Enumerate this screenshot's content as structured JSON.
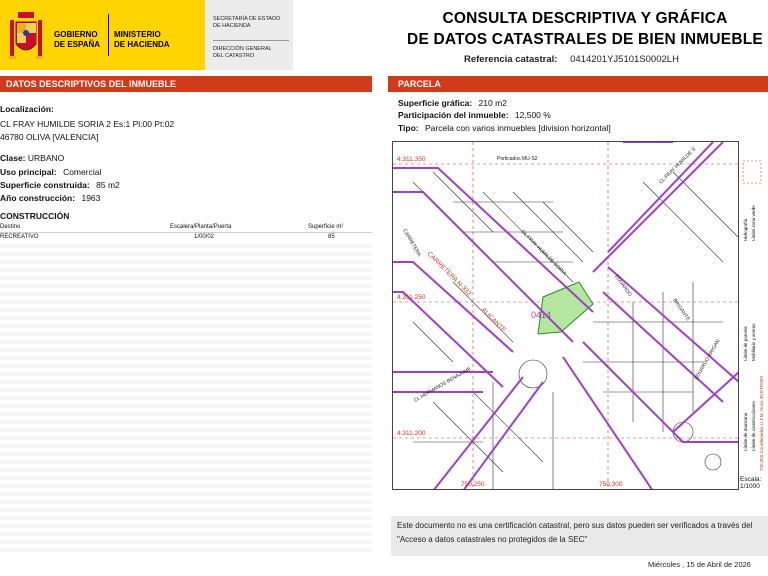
{
  "header": {
    "gobierno": [
      "GOBIERNO",
      "DE ESPAÑA"
    ],
    "ministerio": [
      "MINISTERIO",
      "DE HACIENDA"
    ],
    "secretaria": [
      "SECRETARÍA DE ESTADO",
      "DE HACIENDA"
    ],
    "direccion": [
      "DIRECCIÓN GENERAL",
      "DEL CATASTRO"
    ],
    "title_line1": "CONSULTA DESCRIPTIVA Y GRÁFICA",
    "title_line2": "DE DATOS CATASTRALES DE BIEN INMUEBLE",
    "ref_label": "Referencia catastral:",
    "ref_value": "0414201YJ5101S0002LH"
  },
  "left": {
    "section_title": "DATOS DESCRIPTIVOS DEL INMUEBLE",
    "localizacion_label": "Localización:",
    "address1": "CL FRAY HUMILDE SORIA 2 Es:1 Pl:00 Pt:02",
    "address2": "46780 OLIVA [VALENCIA]",
    "clase_label": "Clase:",
    "clase_value": "URBANO",
    "uso_label": "Uso principal:",
    "uso_value": "Comercial",
    "superficie_label": "Superficie construida:",
    "superficie_value": "85 m2",
    "anio_label": "Año construcción:",
    "anio_value": "1963",
    "construccion_title": "CONSTRUCCIÓN",
    "table_headers": [
      "Destino",
      "Escalera/Planta/Puerta",
      "Superficie m²"
    ],
    "table_rows": [
      [
        "RECREATIVO",
        "1/00/02",
        "85"
      ]
    ]
  },
  "right": {
    "section_title": "PARCELA",
    "sup_grafica_label": "Superficie gráfica:",
    "sup_grafica_value": "210 m2",
    "participacion_label": "Participación del inmueble:",
    "participacion_value": "12,500 %",
    "tipo_label": "Tipo:",
    "tipo_value": "Parcela con varios inmuebles [division horizontal]"
  },
  "map": {
    "coord_y1": "4.311.350",
    "coord_y2": "4.311.250",
    "coord_y3": "4.311.200",
    "coord_x1": "750,250",
    "coord_x2": "750,300",
    "street1": "CARRETERA N-332",
    "street2": "CL FRAY HUMILDE SORIA",
    "street3": "ALICANTE",
    "street4": "CL HERMANOS BENAJUME",
    "street5": "CL FRAY HUMILDE S",
    "street6": "CARRETERA",
    "street7": "EDUARDO",
    "street8": "BRIGANTE",
    "street9": "EDUARDO BRIGAN",
    "parcel_ref": "0414",
    "porticos": "Porticados MU-S2",
    "legend": [
      "Límite de parcela",
      "Hidrografía",
      "Límite zona verde",
      "Límite de manzana",
      "Mobiliario y aceras",
      "Límite de construcciones",
      "750,350 Coordenadas U.T.M. Huso 30 ETRS89"
    ],
    "scale_label": "Escala:",
    "scale_value": "1/1000"
  },
  "footer": {
    "disclaimer": "Este documento no es una certificación catastral, pero sus datos pueden ser verificados a través del \"Acceso a datos catastrales no protegidos de la SEC\"",
    "date": "Miércoles , 15 de Abril de 2026"
  },
  "colors": {
    "header_red": "#d23a1c",
    "logo_yellow": "#ffd400",
    "road_purple": "#a040c8",
    "parcel_green": "#b4e6a0",
    "map_red": "#e03020"
  }
}
